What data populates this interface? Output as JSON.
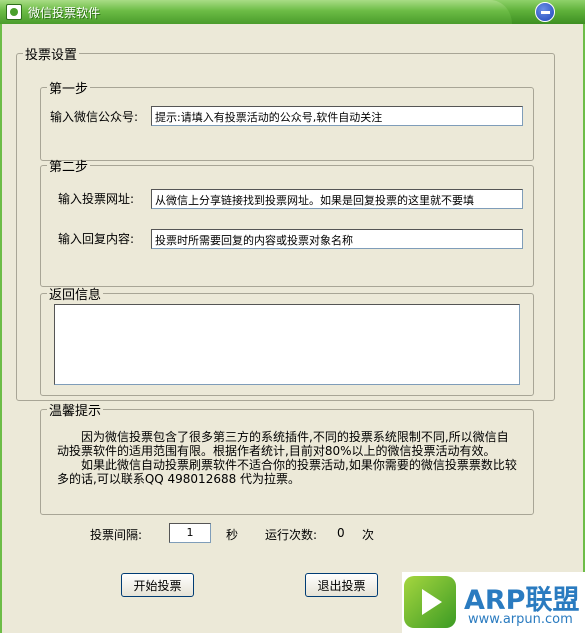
{
  "window": {
    "title": "微信投票软件"
  },
  "vote_settings": {
    "legend": "投票设置",
    "step1": {
      "legend": "第一步",
      "account_label": "输入微信公众号:",
      "account_value": "提示:请填入有投票活动的公众号,软件自动关注"
    },
    "step2": {
      "legend": "第二步",
      "url_label": "输入投票网址:",
      "url_value": "从微信上分享链接找到投票网址。如果是回复投票的这里就不要填",
      "reply_label": "输入回复内容:",
      "reply_value": "投票时所需要回复的内容或投票对象名称"
    },
    "return_info": {
      "legend": "返回信息",
      "value": ""
    },
    "tips": {
      "legend": "温馨提示",
      "para1": "因为微信投票包含了很多第三方的系统插件,不同的投票系统限制不同,所以微信自动投票软件的适用范围有限。根据作者统计,目前对80%以上的微信投票活动有效。",
      "para2": "如果此微信自动投票刷票软件不适合你的投票活动,如果你需要的微信投票票数比较多的话,可以联系QQ 498012688 代为拉票。"
    }
  },
  "controls": {
    "interval_label": "投票间隔:",
    "interval_value": "1",
    "interval_unit": "秒",
    "run_count_label": "运行次数:",
    "run_count_value": "0",
    "run_count_unit": "次",
    "start_button": "开始投票",
    "exit_button": "退出投票"
  },
  "watermark": {
    "brand": "ARP联盟",
    "url": "www.arpun.com"
  },
  "colors": {
    "titlebar": "#5fb13a",
    "brand": "#2a7bc0"
  }
}
